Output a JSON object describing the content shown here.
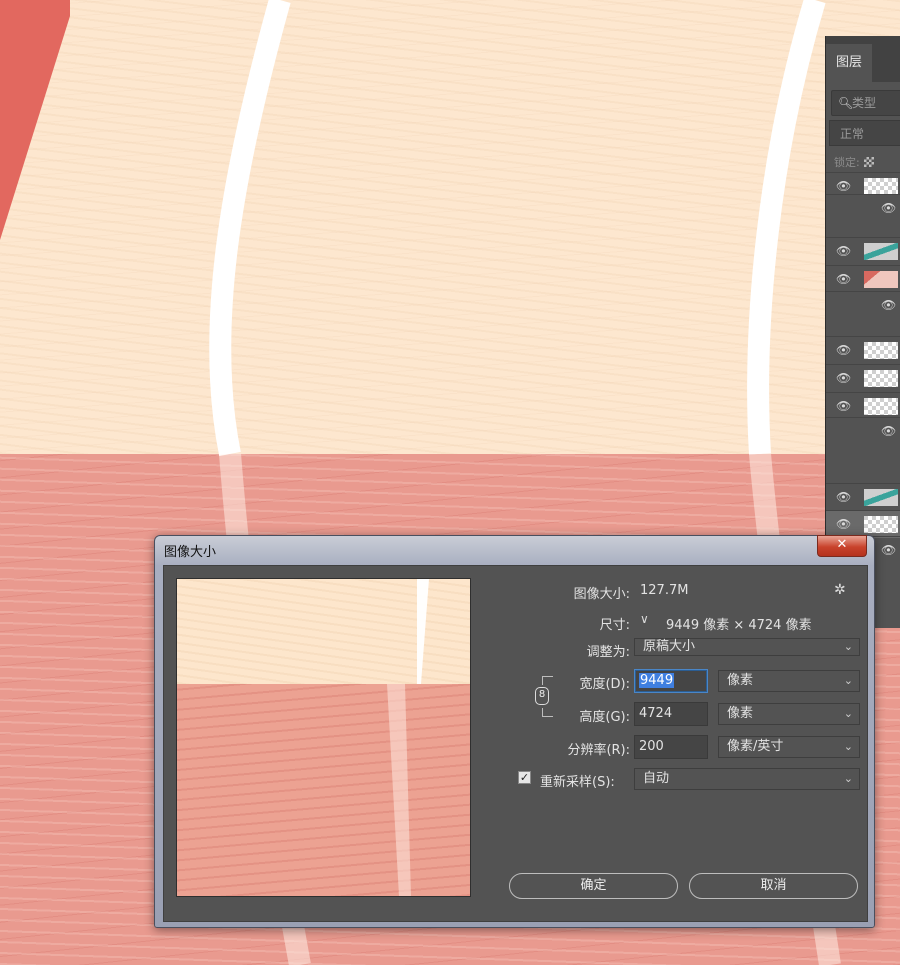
{
  "layers_panel": {
    "tab": "图层",
    "search_placeholder": "类型",
    "blend_mode": "正常",
    "lock_label": "锁定:"
  },
  "dialog": {
    "title": "图像大小",
    "close_symbol": "✕",
    "image_size_label": "图像大小:",
    "image_size_value": "127.7M",
    "dimensions_label": "尺寸:",
    "dimensions_value": "9449 像素  ×  4724 像素",
    "fit_to_label": "调整为:",
    "fit_to_value": "原稿大小",
    "width_label": "宽度(D):",
    "width_value": "9449",
    "width_unit": "像素",
    "height_label": "高度(G):",
    "height_value": "4724",
    "height_unit": "像素",
    "resolution_label": "分辨率(R):",
    "resolution_value": "200",
    "resolution_unit": "像素/英寸",
    "resample_label": "重新采样(S):",
    "resample_value": "自动",
    "resample_checked": true,
    "ok_label": "确定",
    "cancel_label": "取消"
  }
}
